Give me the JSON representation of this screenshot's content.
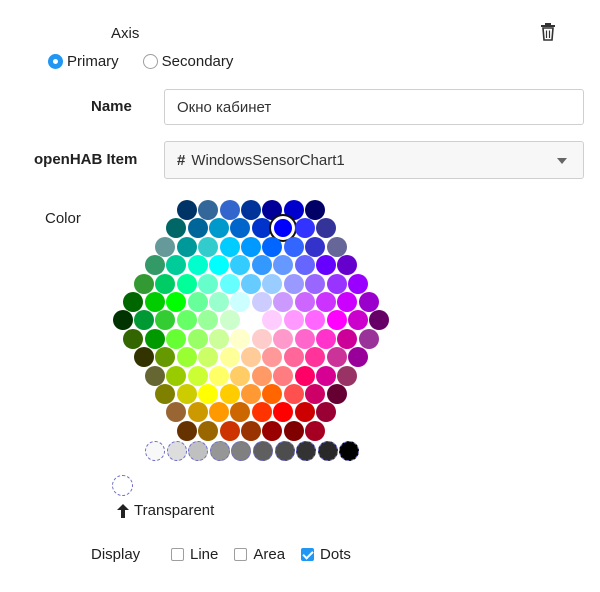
{
  "axis": {
    "title": "Axis",
    "delete_icon": "trash-icon"
  },
  "axis_type": {
    "options": [
      {
        "label": "Primary",
        "checked": true
      },
      {
        "label": "Secondary",
        "checked": false
      }
    ]
  },
  "name": {
    "label": "Name",
    "value": "Окно кабинет"
  },
  "item": {
    "label": "openHAB Item",
    "prefix": "#",
    "value": "WindowsSensorChart1"
  },
  "color": {
    "label": "Color",
    "selected": "#0000ff",
    "hex_rows": [
      [
        "#003366",
        "#336699",
        "#3366CC",
        "#003399",
        "#000099",
        "#0000CC",
        "#000066"
      ],
      [
        "#006666",
        "#006699",
        "#0099CC",
        "#0066CC",
        "#0033CC",
        "#0000FF",
        "#3333FF",
        "#333399"
      ],
      [
        "#669999",
        "#009999",
        "#33CCCC",
        "#00CCFF",
        "#0099FF",
        "#0066FF",
        "#3366FF",
        "#3333CC",
        "#666699"
      ],
      [
        "#339966",
        "#00CC99",
        "#00FFCC",
        "#00FFFF",
        "#33CCFF",
        "#3399FF",
        "#6699FF",
        "#6666FF",
        "#6600FF",
        "#6600CC"
      ],
      [
        "#339933",
        "#00CC66",
        "#00FF99",
        "#66FFCC",
        "#66FFFF",
        "#66CCFF",
        "#99CCFF",
        "#9999FF",
        "#9966FF",
        "#9933FF",
        "#9900FF"
      ],
      [
        "#006600",
        "#00CC00",
        "#00FF00",
        "#66FF99",
        "#99FFCC",
        "#CCFFFF",
        "#CCCCFF",
        "#CC99FF",
        "#CC66FF",
        "#CC33FF",
        "#CC00FF",
        "#9900CC"
      ],
      [
        "#003300",
        "#009933",
        "#33CC33",
        "#66FF66",
        "#99FF99",
        "#CCFFCC",
        "#FFFFFF",
        "#FFCCFF",
        "#FF99FF",
        "#FF66FF",
        "#FF00FF",
        "#CC00CC",
        "#660066"
      ],
      [
        "#336600",
        "#009900",
        "#66FF33",
        "#99FF66",
        "#CCFF99",
        "#FFFFCC",
        "#FFCCCC",
        "#FF99CC",
        "#FF66CC",
        "#FF33CC",
        "#CC0099",
        "#993399"
      ],
      [
        "#333300",
        "#669900",
        "#99FF33",
        "#CCFF66",
        "#FFFF99",
        "#FFCC99",
        "#FF9999",
        "#FF6699",
        "#FF3399",
        "#CC3399",
        "#990099"
      ],
      [
        "#666633",
        "#99CC00",
        "#CCFF33",
        "#FFFF66",
        "#FFCC66",
        "#FF9966",
        "#FF7C80",
        "#FF0066",
        "#D60093",
        "#993366"
      ],
      [
        "#808000",
        "#CCCC00",
        "#FFFF00",
        "#FFCC00",
        "#FF9933",
        "#FF6600",
        "#FF5050",
        "#CC0066",
        "#660033"
      ],
      [
        "#996633",
        "#CC9900",
        "#FF9900",
        "#CC6600",
        "#FF3300",
        "#FF0000",
        "#CC0000",
        "#990033"
      ],
      [
        "#663300",
        "#996600",
        "#CC3300",
        "#993300",
        "#990000",
        "#800000",
        "#A50021"
      ]
    ],
    "grays": [
      "#F8F8F8",
      "#DDDDDD",
      "#C0C0C0",
      "#969696",
      "#808080",
      "#5F5F5F",
      "#4D4D4D",
      "#333333",
      "#292929",
      "#000000"
    ],
    "transparent_label": "Transparent",
    "transparent_icon": "arrow-up-icon"
  },
  "display": {
    "label": "Display",
    "options": [
      {
        "label": "Line",
        "checked": false
      },
      {
        "label": "Area",
        "checked": false
      },
      {
        "label": "Dots",
        "checked": true
      }
    ]
  }
}
